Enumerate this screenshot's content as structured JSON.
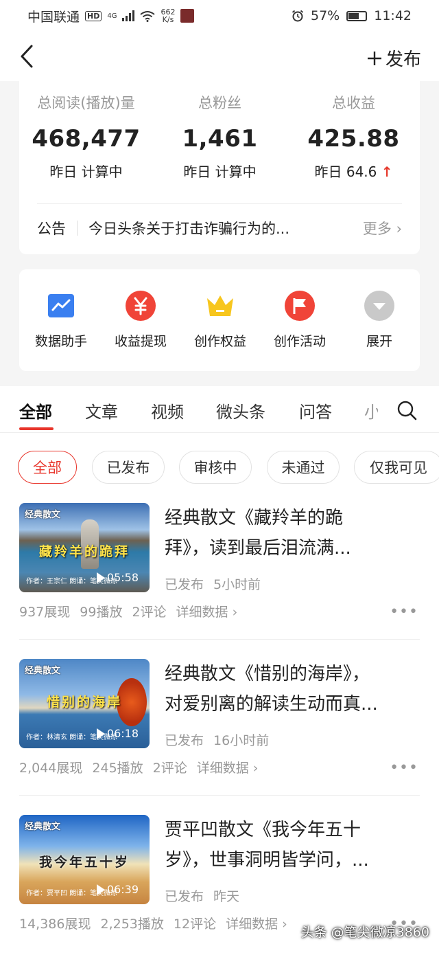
{
  "status_bar": {
    "carrier": "中国联通",
    "hd": "HD",
    "net_gen": "4G",
    "speed_top": "662",
    "speed_bottom": "K/s",
    "battery": "57%",
    "time": "11:42"
  },
  "nav": {
    "publish_label": "发布"
  },
  "stats": {
    "reads": {
      "label": "总阅读(播放)量",
      "value": "468,477",
      "sub": "昨日 计算中"
    },
    "fans": {
      "label": "总粉丝",
      "value": "1,461",
      "sub": "昨日 计算中"
    },
    "income": {
      "label": "总收益",
      "value": "425.88",
      "sub": "昨日 64.6",
      "arrow": "↑"
    }
  },
  "notice": {
    "tag": "公告",
    "text": "今日头条关于打击诈骗行为的...",
    "more": "更多 ›"
  },
  "tools": [
    {
      "label": "数据助手",
      "icon": "chart-icon",
      "color": "#3a7ff0"
    },
    {
      "label": "收益提现",
      "icon": "yuan-icon",
      "color": "#f04438"
    },
    {
      "label": "创作权益",
      "icon": "crown-icon",
      "color": "#f7c61e"
    },
    {
      "label": "创作活动",
      "icon": "flag-icon",
      "color": "#f04438"
    },
    {
      "label": "展开",
      "icon": "expand-icon",
      "color": "#c9c9c9"
    }
  ],
  "tabs": [
    "全部",
    "文章",
    "视频",
    "微头条",
    "问答",
    "小"
  ],
  "chips": [
    "全部",
    "已发布",
    "审核中",
    "未通过",
    "仅我可见"
  ],
  "items": [
    {
      "badge": "经典散文",
      "thumb_title": "藏羚羊的跪拜",
      "author": "作者：王宗仁  朗诵：笔尖微凉",
      "duration": "05:58",
      "title_line1": "经典散文《藏羚羊的跪",
      "title_line2": "拜》，读到最后泪流满...",
      "status": "已发布",
      "time": "5小时前",
      "views": "937展现",
      "plays": "99播放",
      "comments": "2评论",
      "detail": "详细数据 ›"
    },
    {
      "badge": "经典散文",
      "thumb_title": "惜别的海岸",
      "author": "作者：林清玄  朗诵：笔尖微凉",
      "duration": "06:18",
      "title_line1": "经典散文《惜别的海岸》，",
      "title_line2": "对爱别离的解读生动而真...",
      "status": "已发布",
      "time": "16小时前",
      "views": "2,044展现",
      "plays": "245播放",
      "comments": "2评论",
      "detail": "详细数据 ›"
    },
    {
      "badge": "经典散文",
      "thumb_title": "我今年五十岁",
      "author": "作者：贾平凹  朗诵：笔尖微凉",
      "duration": "06:39",
      "title_line1": "贾平凹散文《我今年五十",
      "title_line2": "岁》，世事洞明皆学问，...",
      "status": "已发布",
      "time": "昨天",
      "views": "14,386展现",
      "plays": "2,253播放",
      "comments": "12评论",
      "detail": "详细数据 ›"
    }
  ],
  "watermark": "头条 @笔尖微凉3860"
}
